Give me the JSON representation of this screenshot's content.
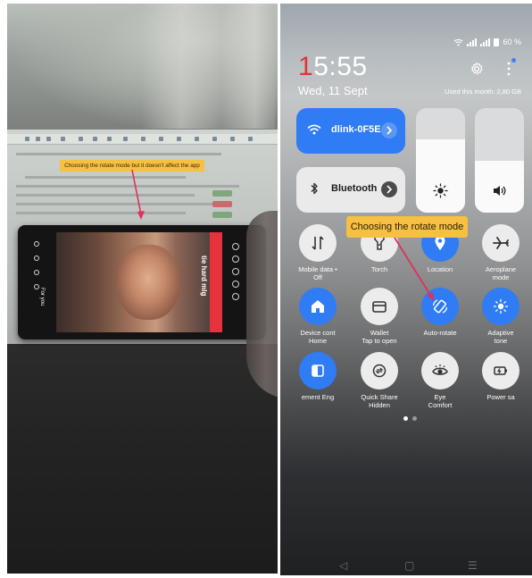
{
  "left_photo": {
    "annotation": "Choosing the rotate mode but it doesn't affect the app",
    "phone_tab": "For you",
    "overlay_text": "tie hard mlg"
  },
  "panel": {
    "clock": "15:55",
    "clock_first": "1",
    "clock_rest": "5:55",
    "date": "Wed, 11 Sept",
    "battery": "60 %",
    "usage": "Used this month: 2,80 GB",
    "accent": "#2f7cf4",
    "wifi_tile": {
      "label": "dlink-0F5E",
      "icon": "wifi-icon"
    },
    "bt_tile": {
      "label": "Bluetooth",
      "icon": "bluetooth-icon"
    },
    "brightness_level": 0.7,
    "volume_level": 0.5,
    "callout": "Choosing the rotate mode",
    "tiles": [
      {
        "line1": "Mobile data •",
        "line2": "Off",
        "state": "off",
        "icon": "mobile-data-icon"
      },
      {
        "line1": "Torch",
        "line2": "",
        "state": "off",
        "icon": "torch-icon"
      },
      {
        "line1": "Location",
        "line2": "",
        "state": "on",
        "icon": "location-icon"
      },
      {
        "line1": "Aeroplane",
        "line2": "mode",
        "state": "off",
        "icon": "airplane-icon"
      },
      {
        "line1": "Device cont",
        "line2": "Home",
        "state": "on",
        "icon": "home-icon"
      },
      {
        "line1": "Wallet",
        "line2": "Tap to open",
        "state": "off",
        "icon": "wallet-icon"
      },
      {
        "line1": "Auto-rotate",
        "line2": "",
        "state": "on",
        "icon": "rotate-icon"
      },
      {
        "line1": "Adaptive",
        "line2": "tone",
        "state": "on",
        "icon": "adaptive-tone-icon"
      },
      {
        "line1": "ement Eng",
        "line2": "",
        "state": "on",
        "icon": "screen-engine-icon"
      },
      {
        "line1": "Quick Share",
        "line2": "Hidden",
        "state": "off",
        "icon": "quick-share-icon"
      },
      {
        "line1": "Eye",
        "line2": "Comfort",
        "state": "off",
        "icon": "eye-comfort-icon"
      },
      {
        "line1": "Power sa",
        "line2": "",
        "state": "off",
        "icon": "battery-saver-icon"
      }
    ],
    "page_dots": {
      "count": 2,
      "active": 0
    }
  }
}
